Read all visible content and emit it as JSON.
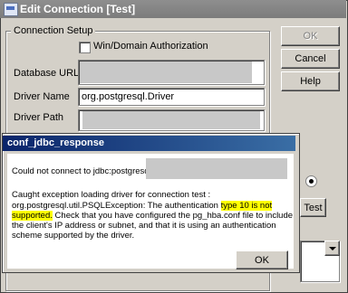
{
  "window": {
    "title": "Edit Connection [Test]"
  },
  "group": {
    "label": "Connection Setup"
  },
  "win_auth": {
    "label": "Win/Domain Authorization"
  },
  "fields": {
    "database_url_label": "Database URL",
    "driver_name_label": "Driver Name",
    "driver_name_value": "org.postgresql.Driver",
    "driver_path_label": "Driver Path"
  },
  "buttons": {
    "ok": "OK",
    "cancel": "Cancel",
    "help": "Help",
    "test": "Test"
  },
  "dialog": {
    "title": "conf_jdbc_response",
    "line1": "Could not connect to jdbc:postgresql:",
    "line2": "Caught exception loading driver for connection test :",
    "line3a": "org.postgresql.util.PSQLException: The authentication ",
    "line3b": "type 10 is not",
    "line4a": "supported.",
    "line4b": " Check that you have configured the pg_hba.conf file to include",
    "line5": "the client's IP address or subnet, and that it is using an authentication",
    "line6": "scheme supported by the driver.",
    "ok": "OK"
  }
}
